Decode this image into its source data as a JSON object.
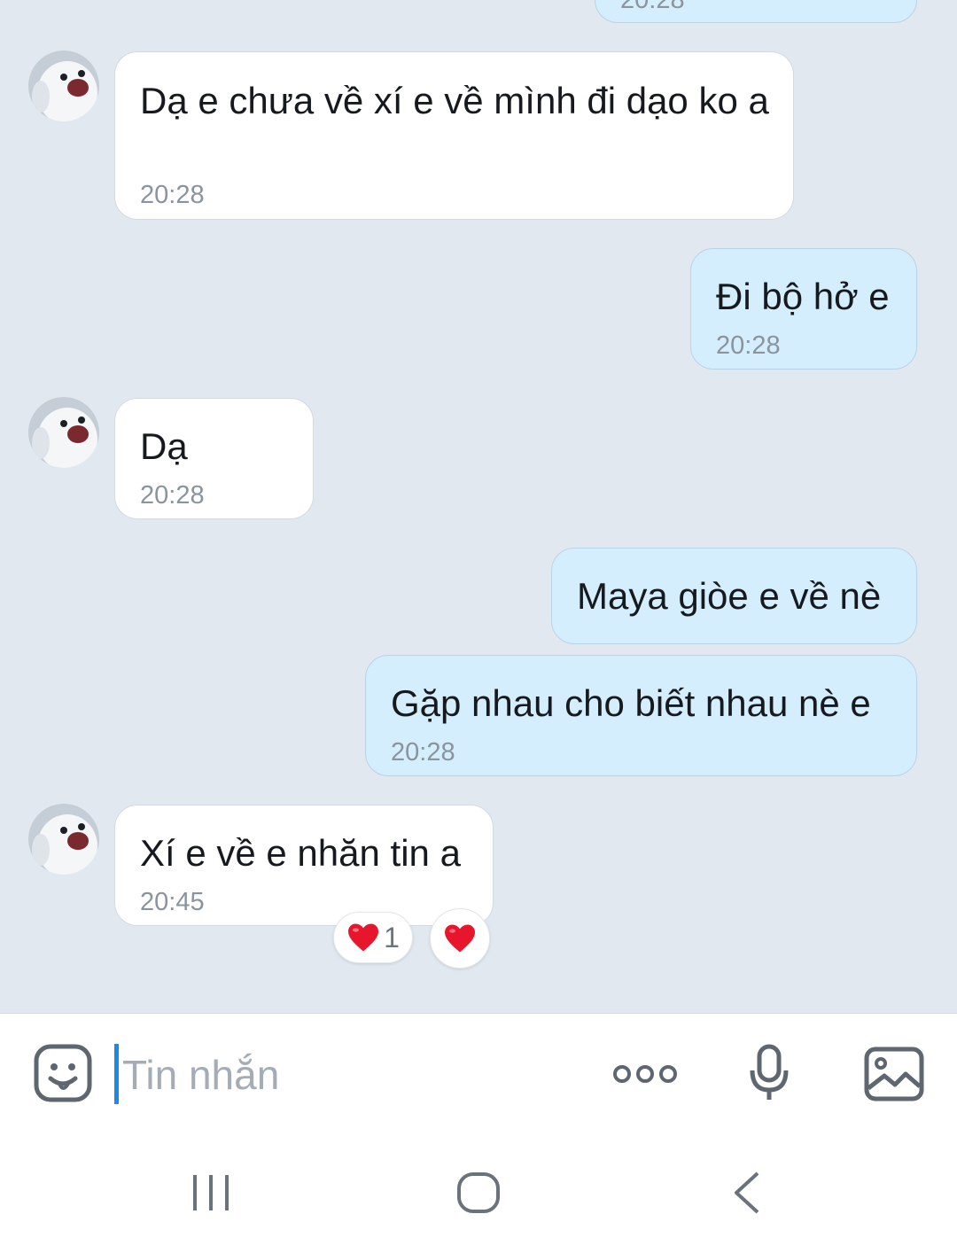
{
  "messages": [
    {
      "id": "m0",
      "dir": "out",
      "text": "",
      "time": "20:28",
      "partial": true
    },
    {
      "id": "m1",
      "dir": "in",
      "text": "Dạ e chưa về xí e về mình đi dạo ko a",
      "time": "20:28"
    },
    {
      "id": "m2",
      "dir": "out",
      "text": "Đi bộ hở e",
      "time": "20:28"
    },
    {
      "id": "m3",
      "dir": "in",
      "text": "Dạ",
      "time": "20:28"
    },
    {
      "id": "m4",
      "dir": "out",
      "text": "Maya giòe e về nè",
      "time": ""
    },
    {
      "id": "m5",
      "dir": "out",
      "text": "Gặp nhau cho biết nhau nè e",
      "time": "20:28"
    },
    {
      "id": "m6",
      "dir": "in",
      "text": "Xí e về e nhăn tin a",
      "time": "20:45"
    }
  ],
  "reactions": {
    "summary": {
      "emoji": "heart-emoji",
      "count": "1"
    },
    "add": {
      "emoji": "heart-emoji"
    }
  },
  "input": {
    "placeholder": "Tin nhắn"
  },
  "icons": {
    "sticker": "sticker-face-icon",
    "more": "more-dots-icon",
    "mic": "microphone-icon",
    "gallery": "image-gallery-icon",
    "nav_recent": "recent-apps-icon",
    "nav_home": "home-icon",
    "nav_back": "back-icon"
  },
  "colors": {
    "chat_bg": "#e2e8f0",
    "incoming_bubble": "#ffffff",
    "outgoing_bubble": "#d5eefd",
    "caret": "#1e88e5",
    "heart": "#e8162c"
  }
}
